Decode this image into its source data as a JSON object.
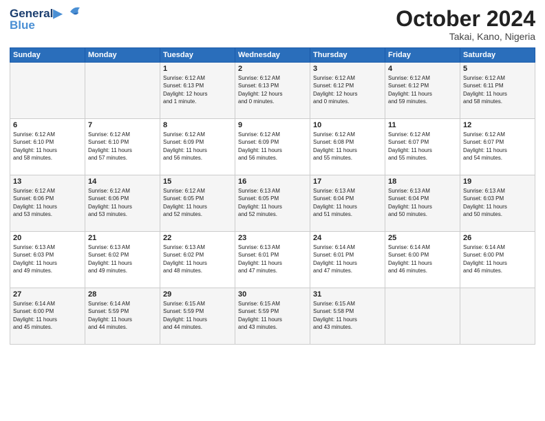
{
  "header": {
    "logo_line1": "General",
    "logo_line2": "Blue",
    "month": "October 2024",
    "location": "Takai, Kano, Nigeria"
  },
  "weekdays": [
    "Sunday",
    "Monday",
    "Tuesday",
    "Wednesday",
    "Thursday",
    "Friday",
    "Saturday"
  ],
  "weeks": [
    [
      {
        "day": "",
        "info": ""
      },
      {
        "day": "",
        "info": ""
      },
      {
        "day": "1",
        "info": "Sunrise: 6:12 AM\nSunset: 6:13 PM\nDaylight: 12 hours\nand 1 minute."
      },
      {
        "day": "2",
        "info": "Sunrise: 6:12 AM\nSunset: 6:13 PM\nDaylight: 12 hours\nand 0 minutes."
      },
      {
        "day": "3",
        "info": "Sunrise: 6:12 AM\nSunset: 6:12 PM\nDaylight: 12 hours\nand 0 minutes."
      },
      {
        "day": "4",
        "info": "Sunrise: 6:12 AM\nSunset: 6:12 PM\nDaylight: 11 hours\nand 59 minutes."
      },
      {
        "day": "5",
        "info": "Sunrise: 6:12 AM\nSunset: 6:11 PM\nDaylight: 11 hours\nand 58 minutes."
      }
    ],
    [
      {
        "day": "6",
        "info": "Sunrise: 6:12 AM\nSunset: 6:10 PM\nDaylight: 11 hours\nand 58 minutes."
      },
      {
        "day": "7",
        "info": "Sunrise: 6:12 AM\nSunset: 6:10 PM\nDaylight: 11 hours\nand 57 minutes."
      },
      {
        "day": "8",
        "info": "Sunrise: 6:12 AM\nSunset: 6:09 PM\nDaylight: 11 hours\nand 56 minutes."
      },
      {
        "day": "9",
        "info": "Sunrise: 6:12 AM\nSunset: 6:09 PM\nDaylight: 11 hours\nand 56 minutes."
      },
      {
        "day": "10",
        "info": "Sunrise: 6:12 AM\nSunset: 6:08 PM\nDaylight: 11 hours\nand 55 minutes."
      },
      {
        "day": "11",
        "info": "Sunrise: 6:12 AM\nSunset: 6:07 PM\nDaylight: 11 hours\nand 55 minutes."
      },
      {
        "day": "12",
        "info": "Sunrise: 6:12 AM\nSunset: 6:07 PM\nDaylight: 11 hours\nand 54 minutes."
      }
    ],
    [
      {
        "day": "13",
        "info": "Sunrise: 6:12 AM\nSunset: 6:06 PM\nDaylight: 11 hours\nand 53 minutes."
      },
      {
        "day": "14",
        "info": "Sunrise: 6:12 AM\nSunset: 6:06 PM\nDaylight: 11 hours\nand 53 minutes."
      },
      {
        "day": "15",
        "info": "Sunrise: 6:12 AM\nSunset: 6:05 PM\nDaylight: 11 hours\nand 52 minutes."
      },
      {
        "day": "16",
        "info": "Sunrise: 6:13 AM\nSunset: 6:05 PM\nDaylight: 11 hours\nand 52 minutes."
      },
      {
        "day": "17",
        "info": "Sunrise: 6:13 AM\nSunset: 6:04 PM\nDaylight: 11 hours\nand 51 minutes."
      },
      {
        "day": "18",
        "info": "Sunrise: 6:13 AM\nSunset: 6:04 PM\nDaylight: 11 hours\nand 50 minutes."
      },
      {
        "day": "19",
        "info": "Sunrise: 6:13 AM\nSunset: 6:03 PM\nDaylight: 11 hours\nand 50 minutes."
      }
    ],
    [
      {
        "day": "20",
        "info": "Sunrise: 6:13 AM\nSunset: 6:03 PM\nDaylight: 11 hours\nand 49 minutes."
      },
      {
        "day": "21",
        "info": "Sunrise: 6:13 AM\nSunset: 6:02 PM\nDaylight: 11 hours\nand 49 minutes."
      },
      {
        "day": "22",
        "info": "Sunrise: 6:13 AM\nSunset: 6:02 PM\nDaylight: 11 hours\nand 48 minutes."
      },
      {
        "day": "23",
        "info": "Sunrise: 6:13 AM\nSunset: 6:01 PM\nDaylight: 11 hours\nand 47 minutes."
      },
      {
        "day": "24",
        "info": "Sunrise: 6:14 AM\nSunset: 6:01 PM\nDaylight: 11 hours\nand 47 minutes."
      },
      {
        "day": "25",
        "info": "Sunrise: 6:14 AM\nSunset: 6:00 PM\nDaylight: 11 hours\nand 46 minutes."
      },
      {
        "day": "26",
        "info": "Sunrise: 6:14 AM\nSunset: 6:00 PM\nDaylight: 11 hours\nand 46 minutes."
      }
    ],
    [
      {
        "day": "27",
        "info": "Sunrise: 6:14 AM\nSunset: 6:00 PM\nDaylight: 11 hours\nand 45 minutes."
      },
      {
        "day": "28",
        "info": "Sunrise: 6:14 AM\nSunset: 5:59 PM\nDaylight: 11 hours\nand 44 minutes."
      },
      {
        "day": "29",
        "info": "Sunrise: 6:15 AM\nSunset: 5:59 PM\nDaylight: 11 hours\nand 44 minutes."
      },
      {
        "day": "30",
        "info": "Sunrise: 6:15 AM\nSunset: 5:59 PM\nDaylight: 11 hours\nand 43 minutes."
      },
      {
        "day": "31",
        "info": "Sunrise: 6:15 AM\nSunset: 5:58 PM\nDaylight: 11 hours\nand 43 minutes."
      },
      {
        "day": "",
        "info": ""
      },
      {
        "day": "",
        "info": ""
      }
    ]
  ]
}
